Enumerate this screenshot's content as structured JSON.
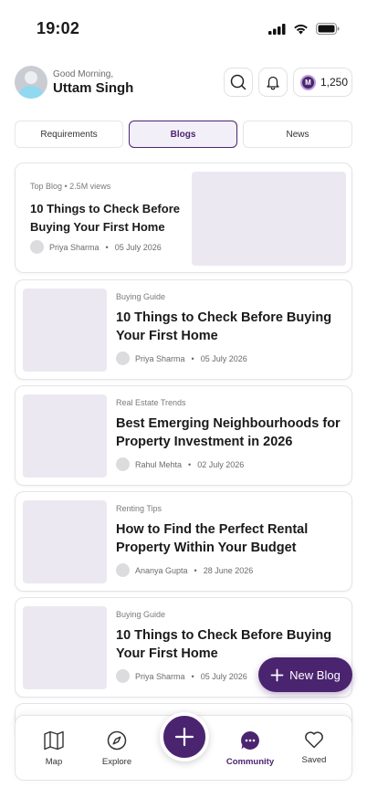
{
  "status_bar": {
    "time": "19:02"
  },
  "header": {
    "greeting": "Good Morning,",
    "user_name": "Uttam Singh",
    "points": "1,250",
    "points_badge": "M"
  },
  "tabs": [
    {
      "label": "Requirements",
      "active": false
    },
    {
      "label": "Blogs",
      "active": true
    },
    {
      "label": "News",
      "active": false
    }
  ],
  "top_blog": {
    "tag": "Top Blog • 2.5M views",
    "title": "10 Things to Check Before Buying Your First Home",
    "author": "Priya Sharma",
    "date": "05 July 2026"
  },
  "blogs": [
    {
      "category": "Buying Guide",
      "title": "10 Things to Check Before Buying Your First Home",
      "author": "Priya Sharma",
      "date": "05 July 2026"
    },
    {
      "category": "Real Estate Trends",
      "title": "Best Emerging Neighbourhoods for Property Investment in 2026",
      "author": "Rahul Mehta",
      "date": "02 July 2026"
    },
    {
      "category": "Renting Tips",
      "title": "How to Find the Perfect Rental Property Within Your Budget",
      "author": "Ananya Gupta",
      "date": "28 June 2026"
    },
    {
      "category": "Buying Guide",
      "title": "10 Things to Check Before Buying Your First Home",
      "author": "Priya Sharma",
      "date": "05 July 2026"
    }
  ],
  "fab": {
    "label": "New Blog"
  },
  "bottom_nav": [
    {
      "label": "Map",
      "icon": "map-icon"
    },
    {
      "label": "Explore",
      "icon": "compass-icon"
    },
    {
      "label": "Community",
      "icon": "chat-bubble-icon",
      "active": true
    },
    {
      "label": "Saved",
      "icon": "heart-icon"
    }
  ],
  "colors": {
    "accent": "#4b2470",
    "thumb": "#ece8f1",
    "active_tab_bg": "#f3eff8"
  }
}
